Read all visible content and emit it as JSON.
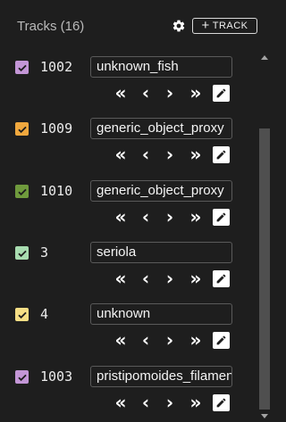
{
  "header": {
    "title": "Tracks (16)",
    "add_button_label": "TRACK",
    "add_button_icon": "plus-icon",
    "settings_icon": "gear-icon"
  },
  "nav_glyphs": {
    "first": "«",
    "prev": "‹",
    "next": "›",
    "last": "»"
  },
  "tracks": [
    {
      "id": "1002",
      "type": "unknown_fish",
      "color": "#c396d6"
    },
    {
      "id": "1009",
      "type": "generic_object_proxy",
      "color": "#f0a83e"
    },
    {
      "id": "1010",
      "type": "generic_object_proxy",
      "color": "#6f9a3d"
    },
    {
      "id": "3",
      "type": "seriola",
      "color": "#a8dcb0"
    },
    {
      "id": "4",
      "type": "unknown",
      "color": "#f5de85"
    },
    {
      "id": "1003",
      "type": "pristipomoides_filamentosus",
      "color": "#c396d6"
    }
  ]
}
